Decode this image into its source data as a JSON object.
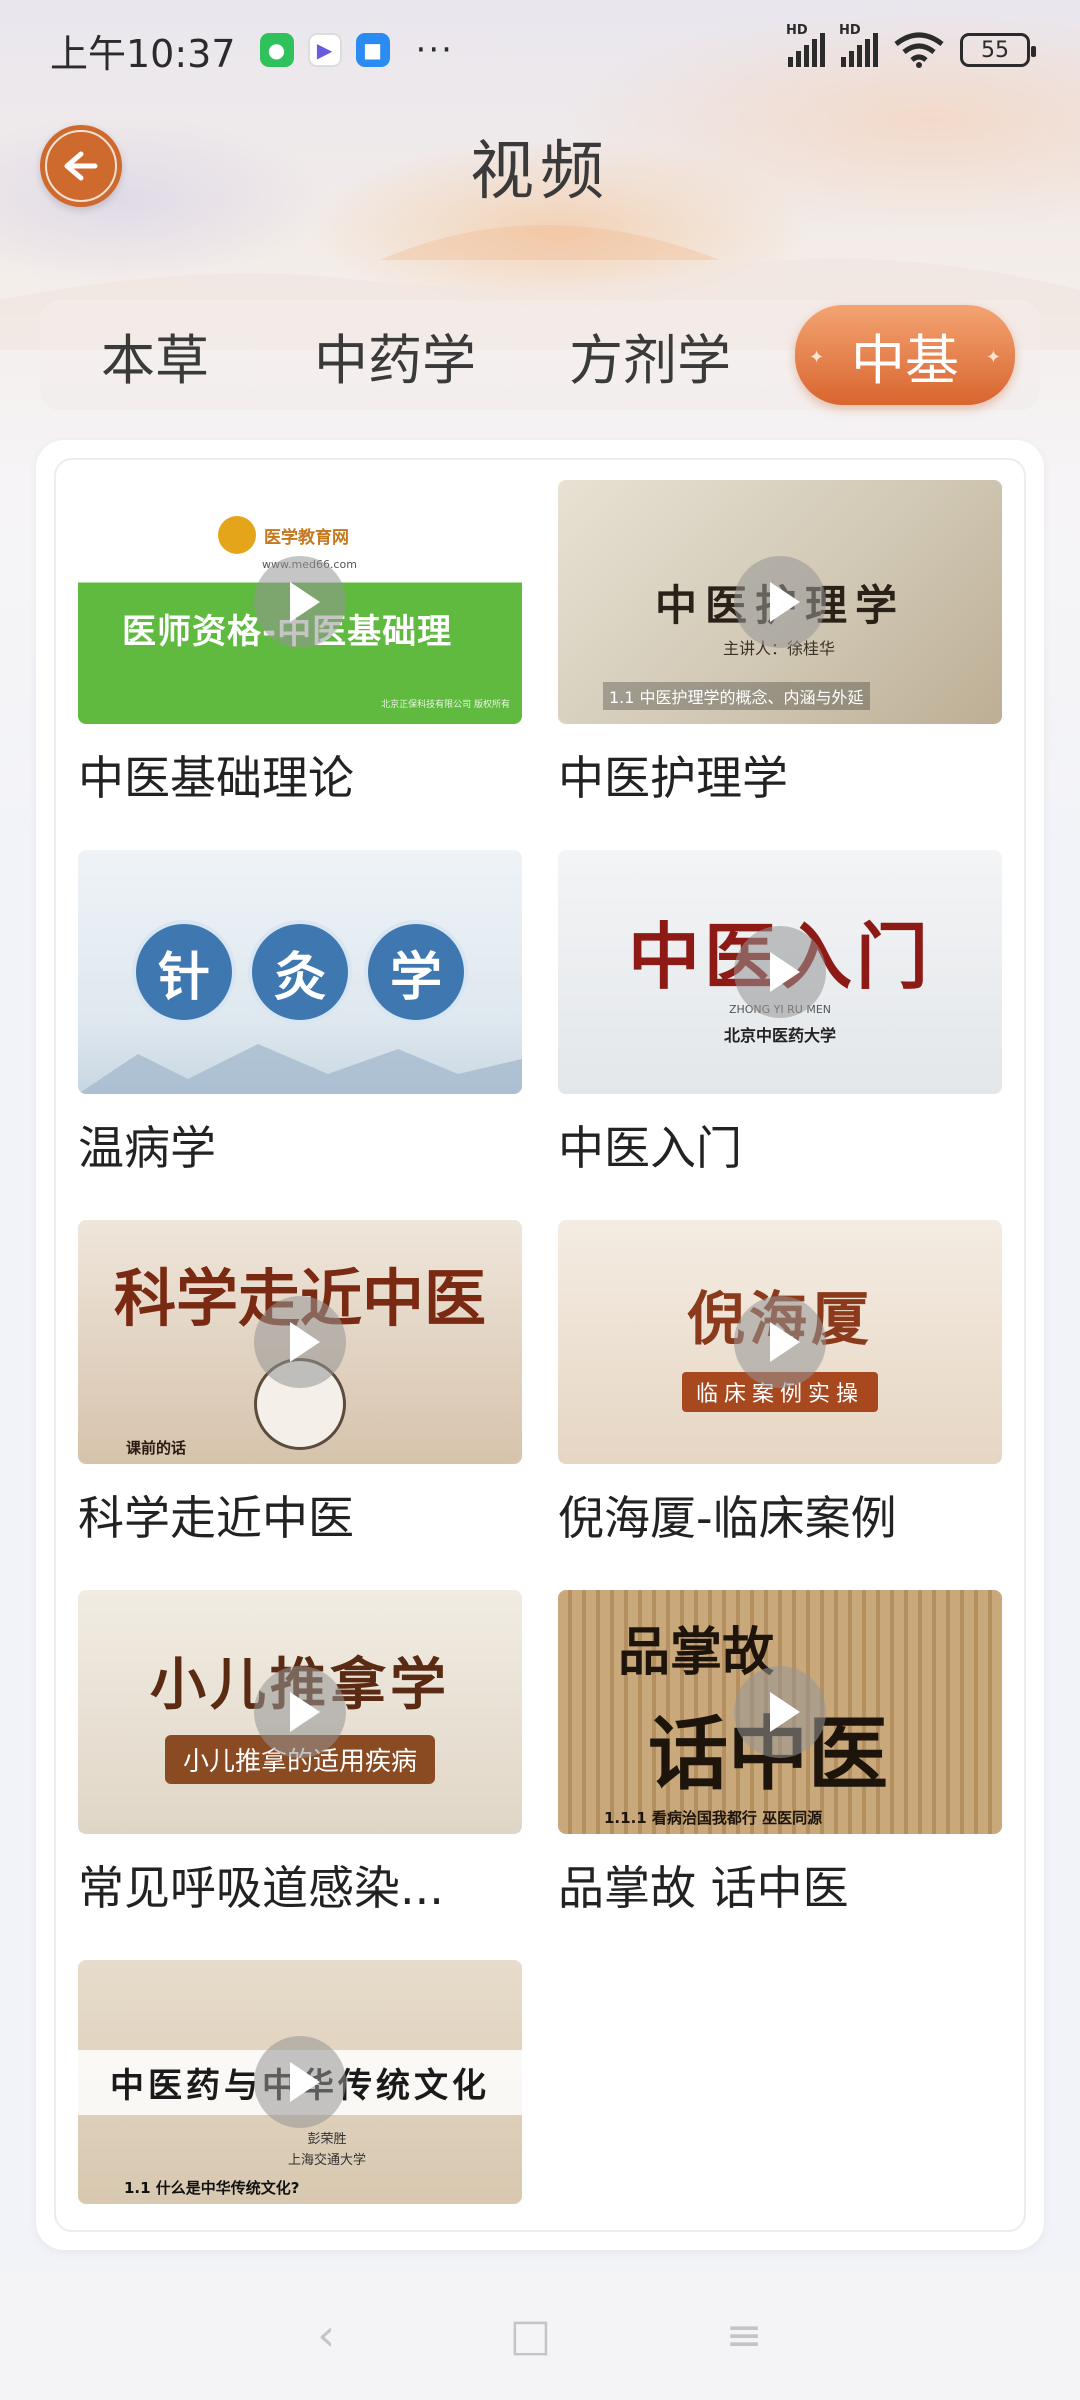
{
  "status_bar": {
    "time": "上午10:37",
    "signal_1_label": "HD",
    "signal_2_label": "HD",
    "battery": "55",
    "overflow": "···"
  },
  "header": {
    "title": "视频",
    "back_icon": "back-arrow-icon"
  },
  "tabs": [
    {
      "label": "本草",
      "active": false
    },
    {
      "label": "中药学",
      "active": false
    },
    {
      "label": "方剂学",
      "active": false
    },
    {
      "label": "中基",
      "active": true
    }
  ],
  "videos": [
    {
      "title": "中医基础理论",
      "thumb": {
        "logo": "医学教育网",
        "url": "www.med66.com",
        "headline": "医师资格-中医基础理",
        "footer": "北京正保科技有限公司 版权所有"
      }
    },
    {
      "title": "中医护理学",
      "thumb": {
        "headline": "中医护理学",
        "speaker": "主讲人：徐桂华",
        "caption": "1.1 中医护理学的概念、内涵与外延"
      }
    },
    {
      "title": "温病学",
      "thumb": {
        "chars": [
          "针",
          "灸",
          "学"
        ]
      }
    },
    {
      "title": "中医入门",
      "thumb": {
        "headline": "中医入门",
        "pinyin": "ZHONG YI RU MEN",
        "sub": "北京中医药大学"
      }
    },
    {
      "title": "科学走近中医",
      "thumb": {
        "headline": "科学走近中医",
        "caption": "课前的话"
      }
    },
    {
      "title": "倪海厦-临床案例",
      "thumb": {
        "headline": "倪海厦",
        "sub": "临床案例实操"
      }
    },
    {
      "title": "常见呼吸道感染...",
      "thumb": {
        "headline": "小儿推拿学",
        "sub": "小儿推拿的适用疾病"
      }
    },
    {
      "title": "品掌故 话中医",
      "thumb": {
        "headline_1": "品掌故",
        "headline_2": "话中医",
        "caption": "1.1.1 看病治国我都行 巫医同源"
      }
    },
    {
      "title": "",
      "thumb": {
        "headline": "中医药与中华传统文化",
        "author": "彭荣胜",
        "school": "上海交通大学",
        "caption": "1.1 什么是中华传统文化?"
      }
    }
  ],
  "colors": {
    "accent": "#d9652f",
    "accent_light": "#f3a472",
    "text": "#222222"
  },
  "nav": {
    "back_icon": "nav-back-icon",
    "home_icon": "nav-home-icon",
    "menu_icon": "nav-menu-icon"
  }
}
